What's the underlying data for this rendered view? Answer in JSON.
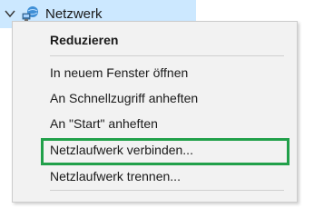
{
  "navigation": {
    "selected_item": {
      "label": "Netzwerk",
      "expand_icon": "chevron-down-icon",
      "icon": "network-icon"
    }
  },
  "context_menu": {
    "items": [
      {
        "label": "Reduzieren",
        "bold": true
      },
      {
        "label": "In neuem Fenster öffnen"
      },
      {
        "label": "An Schnellzugriff anheften"
      },
      {
        "label": "An \"Start\" anheften"
      },
      {
        "label": "Netzlaufwerk verbinden..."
      },
      {
        "label": "Netzlaufwerk trennen..."
      }
    ]
  },
  "colors": {
    "selection_background": "#cce8ff",
    "menu_background": "#f2f2f2",
    "highlight_border": "#21a04a"
  }
}
